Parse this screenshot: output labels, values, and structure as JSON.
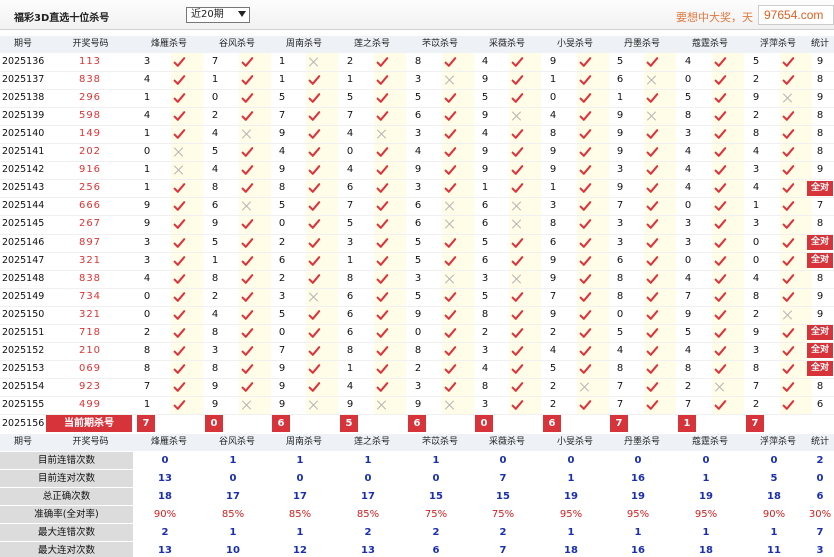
{
  "header": {
    "title": "福彩3D直选十位杀号",
    "period_select": "近20期",
    "slogan": "要想中大奖，天",
    "site": "97654.com"
  },
  "table": {
    "col_issue": "期号",
    "col_draw": "开奖号码",
    "col_stat": "统计",
    "experts": [
      "烽雁杀号",
      "谷风杀号",
      "周南杀号",
      "莲之杀号",
      "芣苡杀号",
      "采薇杀号",
      "小旻杀号",
      "丹墨杀号",
      "蔻霆杀号",
      "浮萍杀号"
    ],
    "full_label": "全对",
    "current_label": "当前期杀号",
    "current_issue": "2025156",
    "current_values": [
      "7",
      "0",
      "6",
      "5",
      "6",
      "0",
      "6",
      "7",
      "1",
      "7"
    ],
    "rows": [
      {
        "issue": "2025136",
        "draw": "113",
        "cells": [
          "3",
          "7",
          "1",
          "2",
          "8",
          "4",
          "9",
          "5",
          "4",
          "5"
        ],
        "ok": [
          1,
          1,
          0,
          1,
          1,
          1,
          1,
          1,
          1,
          1
        ],
        "stat": "9"
      },
      {
        "issue": "2025137",
        "draw": "838",
        "cells": [
          "4",
          "1",
          "1",
          "1",
          "3",
          "9",
          "1",
          "6",
          "0",
          "2"
        ],
        "ok": [
          1,
          1,
          1,
          1,
          0,
          1,
          1,
          0,
          1,
          1
        ],
        "stat": "8"
      },
      {
        "issue": "2025138",
        "draw": "296",
        "cells": [
          "1",
          "0",
          "5",
          "5",
          "5",
          "5",
          "0",
          "1",
          "5",
          "9"
        ],
        "ok": [
          1,
          1,
          1,
          1,
          1,
          1,
          1,
          1,
          1,
          0
        ],
        "stat": "9"
      },
      {
        "issue": "2025139",
        "draw": "598",
        "cells": [
          "4",
          "2",
          "7",
          "7",
          "6",
          "9",
          "4",
          "9",
          "8",
          "2"
        ],
        "ok": [
          1,
          1,
          1,
          1,
          1,
          0,
          1,
          0,
          1,
          1
        ],
        "stat": "8"
      },
      {
        "issue": "2025140",
        "draw": "149",
        "cells": [
          "1",
          "4",
          "9",
          "4",
          "3",
          "4",
          "8",
          "9",
          "3",
          "8"
        ],
        "ok": [
          1,
          0,
          1,
          0,
          1,
          1,
          1,
          1,
          1,
          1
        ],
        "stat": "8"
      },
      {
        "issue": "2025141",
        "draw": "202",
        "cells": [
          "0",
          "5",
          "4",
          "0",
          "4",
          "9",
          "9",
          "9",
          "4",
          "4"
        ],
        "ok": [
          0,
          1,
          1,
          1,
          1,
          1,
          1,
          1,
          1,
          1
        ],
        "stat": "8"
      },
      {
        "issue": "2025142",
        "draw": "916",
        "cells": [
          "1",
          "4",
          "9",
          "4",
          "9",
          "9",
          "9",
          "3",
          "4",
          "3"
        ],
        "ok": [
          0,
          1,
          1,
          1,
          1,
          1,
          1,
          1,
          1,
          1
        ],
        "stat": "9"
      },
      {
        "issue": "2025143",
        "draw": "256",
        "cells": [
          "1",
          "8",
          "8",
          "6",
          "3",
          "1",
          "1",
          "9",
          "4",
          "4"
        ],
        "ok": [
          1,
          1,
          1,
          1,
          1,
          1,
          1,
          1,
          1,
          1
        ],
        "stat": "全对"
      },
      {
        "issue": "2025144",
        "draw": "666",
        "cells": [
          "9",
          "6",
          "5",
          "7",
          "6",
          "6",
          "3",
          "7",
          "0",
          "1"
        ],
        "ok": [
          1,
          0,
          1,
          1,
          0,
          0,
          1,
          1,
          1,
          1
        ],
        "stat": "7"
      },
      {
        "issue": "2025145",
        "draw": "267",
        "cells": [
          "9",
          "9",
          "0",
          "5",
          "6",
          "6",
          "8",
          "3",
          "3",
          "3"
        ],
        "ok": [
          1,
          1,
          1,
          1,
          0,
          0,
          1,
          1,
          1,
          1
        ],
        "stat": "8"
      },
      {
        "issue": "2025146",
        "draw": "897",
        "cells": [
          "3",
          "5",
          "2",
          "3",
          "5",
          "5",
          "6",
          "3",
          "3",
          "0"
        ],
        "ok": [
          1,
          1,
          1,
          1,
          1,
          1,
          1,
          1,
          1,
          1
        ],
        "stat": "全对"
      },
      {
        "issue": "2025147",
        "draw": "321",
        "cells": [
          "3",
          "1",
          "6",
          "1",
          "5",
          "6",
          "9",
          "6",
          "0",
          "0"
        ],
        "ok": [
          1,
          1,
          1,
          1,
          1,
          1,
          1,
          1,
          1,
          1
        ],
        "stat": "全对"
      },
      {
        "issue": "2025148",
        "draw": "838",
        "cells": [
          "4",
          "8",
          "2",
          "8",
          "3",
          "3",
          "9",
          "8",
          "4",
          "4"
        ],
        "ok": [
          1,
          1,
          1,
          1,
          0,
          0,
          1,
          1,
          1,
          1
        ],
        "stat": "8"
      },
      {
        "issue": "2025149",
        "draw": "734",
        "cells": [
          "0",
          "2",
          "3",
          "6",
          "5",
          "5",
          "7",
          "8",
          "7",
          "8"
        ],
        "ok": [
          1,
          1,
          0,
          1,
          1,
          1,
          1,
          1,
          1,
          1
        ],
        "stat": "9"
      },
      {
        "issue": "2025150",
        "draw": "321",
        "cells": [
          "0",
          "4",
          "5",
          "6",
          "9",
          "8",
          "9",
          "0",
          "9",
          "2"
        ],
        "ok": [
          1,
          1,
          1,
          1,
          1,
          1,
          1,
          1,
          1,
          0
        ],
        "stat": "9"
      },
      {
        "issue": "2025151",
        "draw": "718",
        "cells": [
          "2",
          "8",
          "0",
          "6",
          "0",
          "2",
          "2",
          "5",
          "5",
          "9"
        ],
        "ok": [
          1,
          1,
          1,
          1,
          1,
          1,
          1,
          1,
          1,
          1
        ],
        "stat": "全对"
      },
      {
        "issue": "2025152",
        "draw": "210",
        "cells": [
          "8",
          "3",
          "7",
          "8",
          "8",
          "3",
          "4",
          "4",
          "4",
          "3"
        ],
        "ok": [
          1,
          1,
          1,
          1,
          1,
          1,
          1,
          1,
          1,
          1
        ],
        "stat": "全对"
      },
      {
        "issue": "2025153",
        "draw": "069",
        "cells": [
          "8",
          "8",
          "9",
          "1",
          "2",
          "4",
          "5",
          "8",
          "8",
          "8"
        ],
        "ok": [
          1,
          1,
          1,
          1,
          1,
          1,
          1,
          1,
          1,
          1
        ],
        "stat": "全对"
      },
      {
        "issue": "2025154",
        "draw": "923",
        "cells": [
          "7",
          "9",
          "9",
          "4",
          "3",
          "8",
          "2",
          "7",
          "2",
          "7"
        ],
        "ok": [
          1,
          1,
          1,
          1,
          1,
          1,
          0,
          1,
          0,
          1
        ],
        "stat": "8"
      },
      {
        "issue": "2025155",
        "draw": "499",
        "cells": [
          "1",
          "9",
          "9",
          "9",
          "9",
          "3",
          "2",
          "7",
          "7",
          "2"
        ],
        "ok": [
          1,
          0,
          0,
          0,
          0,
          1,
          1,
          1,
          1,
          1
        ],
        "stat": "6"
      }
    ]
  },
  "summary": {
    "header_issue": "期号",
    "header_draw": "开奖号码",
    "rows": [
      {
        "label": "目前连错次数",
        "values": [
          "0",
          "1",
          "1",
          "1",
          "1",
          "0",
          "0",
          "0",
          "0",
          "0"
        ],
        "stat": "2"
      },
      {
        "label": "目前连对次数",
        "values": [
          "13",
          "0",
          "0",
          "0",
          "0",
          "7",
          "1",
          "16",
          "1",
          "5"
        ],
        "stat": "0"
      },
      {
        "label": "总正确次数",
        "values": [
          "18",
          "17",
          "17",
          "17",
          "15",
          "15",
          "19",
          "19",
          "19",
          "18"
        ],
        "stat": "6"
      },
      {
        "label": "准确率(全对率)",
        "values": [
          "90%",
          "85%",
          "85%",
          "85%",
          "75%",
          "75%",
          "95%",
          "95%",
          "95%",
          "90%"
        ],
        "stat": "30%"
      },
      {
        "label": "最大连错次数",
        "values": [
          "2",
          "1",
          "1",
          "2",
          "2",
          "2",
          "1",
          "1",
          "1",
          "1"
        ],
        "stat": "7"
      },
      {
        "label": "最大连对次数",
        "values": [
          "13",
          "10",
          "12",
          "13",
          "6",
          "7",
          "18",
          "16",
          "18",
          "11"
        ],
        "stat": "3"
      }
    ]
  }
}
